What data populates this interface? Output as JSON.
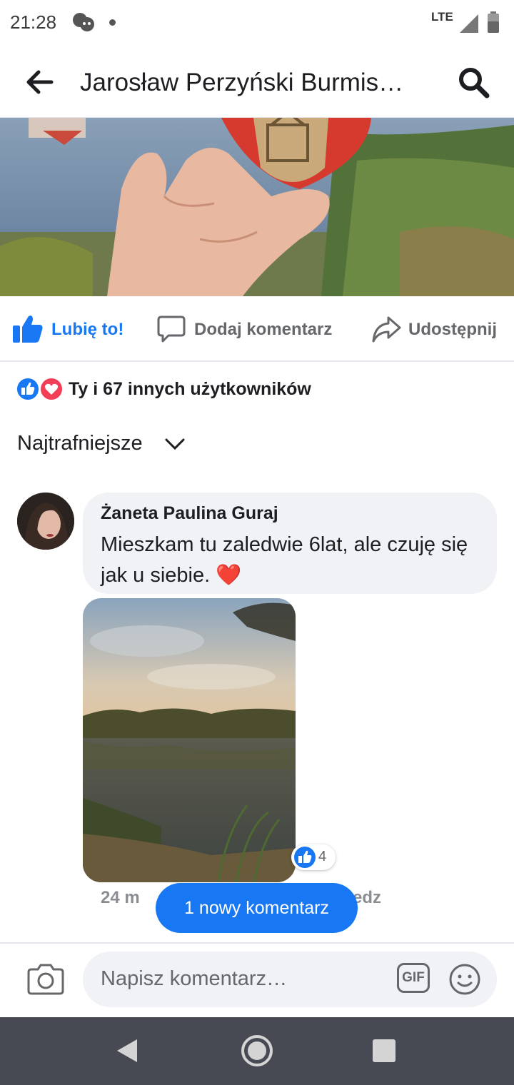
{
  "status": {
    "time": "21:28",
    "network": "LTE"
  },
  "header": {
    "title": "Jarosław Perzyński Burmis…"
  },
  "actions": {
    "like": "Lubię to!",
    "comment": "Dodaj komentarz",
    "share": "Udostępnij"
  },
  "reactions": {
    "summary": "Ty i 67 innych użytkowników"
  },
  "sort": {
    "label": "Najtrafniejsze"
  },
  "comment": {
    "author": "Żaneta Paulina Guraj",
    "text": "Mieszkam tu zaledwie 6lat, ale czuję się jak u siebie.",
    "emoji": "❤️",
    "reaction_count": "4",
    "time": "24 m",
    "reply_partial": "edz"
  },
  "new_comment_pill": "1 nowy komentarz",
  "composer": {
    "placeholder": "Napisz komentarz…",
    "gif": "GIF"
  },
  "colors": {
    "accent": "#1877f2",
    "heart": "#f33e58",
    "text_secondary": "#65676b"
  }
}
